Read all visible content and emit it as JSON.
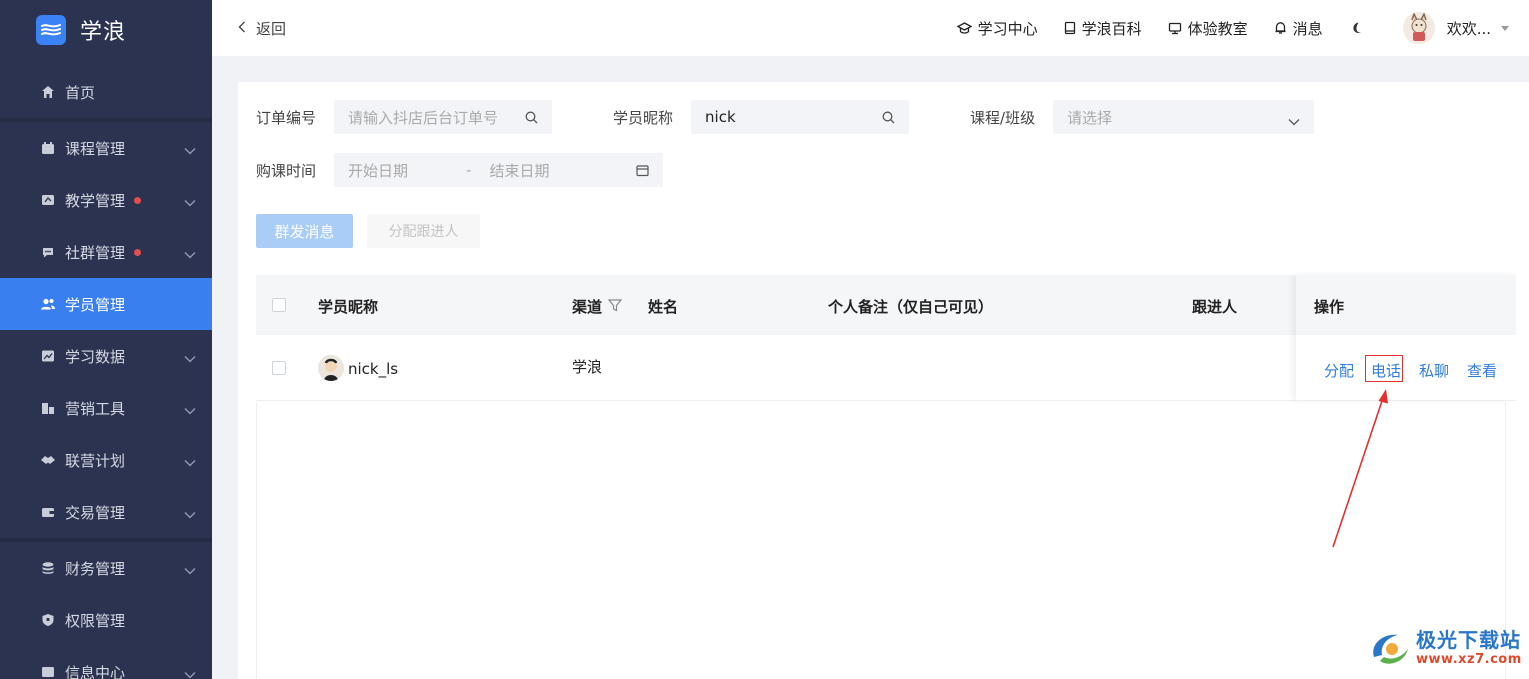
{
  "brand": {
    "name": "学浪"
  },
  "sidebar": {
    "items": [
      {
        "label": "首页",
        "icon": "home-icon",
        "expandable": false,
        "dot": false,
        "active": false
      },
      {
        "label": "课程管理",
        "icon": "course-icon",
        "expandable": true,
        "dot": false,
        "active": false
      },
      {
        "label": "教学管理",
        "icon": "teach-icon",
        "expandable": true,
        "dot": true,
        "active": false
      },
      {
        "label": "社群管理",
        "icon": "community-icon",
        "expandable": true,
        "dot": true,
        "active": false
      },
      {
        "label": "学员管理",
        "icon": "students-icon",
        "expandable": false,
        "dot": false,
        "active": true
      },
      {
        "label": "学习数据",
        "icon": "chart-icon",
        "expandable": true,
        "dot": false,
        "active": false
      },
      {
        "label": "营销工具",
        "icon": "marketing-icon",
        "expandable": true,
        "dot": false,
        "active": false
      },
      {
        "label": "联营计划",
        "icon": "partner-icon",
        "expandable": true,
        "dot": false,
        "active": false
      },
      {
        "label": "交易管理",
        "icon": "wallet-icon",
        "expandable": true,
        "dot": false,
        "active": false
      },
      {
        "label": "财务管理",
        "icon": "finance-icon",
        "expandable": true,
        "dot": false,
        "active": false
      },
      {
        "label": "权限管理",
        "icon": "shield-icon",
        "expandable": false,
        "dot": false,
        "active": false
      },
      {
        "label": "信息中心",
        "icon": "message-icon",
        "expandable": true,
        "dot": false,
        "active": false
      }
    ]
  },
  "topbar": {
    "back_label": "返回",
    "nav": [
      "学习中心",
      "学浪百科",
      "体验教室",
      "消息"
    ],
    "user_name": "欢欢..."
  },
  "filters": {
    "order_label": "订单编号",
    "order_placeholder": "请输入抖店后台订单号",
    "nick_label": "学员昵称",
    "nick_value": "nick",
    "course_label": "课程/班级",
    "course_placeholder": "请选择",
    "time_label": "购课时间",
    "start_placeholder": "开始日期",
    "range_sep": "-",
    "end_placeholder": "结束日期"
  },
  "actions": {
    "broadcast_label": "群发消息",
    "assign_label": "分配跟进人"
  },
  "table": {
    "headers": {
      "nickname": "学员昵称",
      "channel": "渠道",
      "name": "姓名",
      "note": "个人备注（仅自己可见）",
      "follower": "跟进人",
      "ops": "操作"
    },
    "rows": [
      {
        "nickname": "nick_ls",
        "channel": "学浪",
        "name": "",
        "note": "",
        "follower": "",
        "ops": [
          "分配",
          "电话",
          "私聊",
          "查看"
        ]
      }
    ]
  },
  "watermark": {
    "name": "极光下载站",
    "url": "www.xz7.com"
  },
  "colors": {
    "sidebar_bg": "#2b3350",
    "active": "#3a7ff0",
    "link": "#2f7de0",
    "highlight": "#e3312d"
  }
}
